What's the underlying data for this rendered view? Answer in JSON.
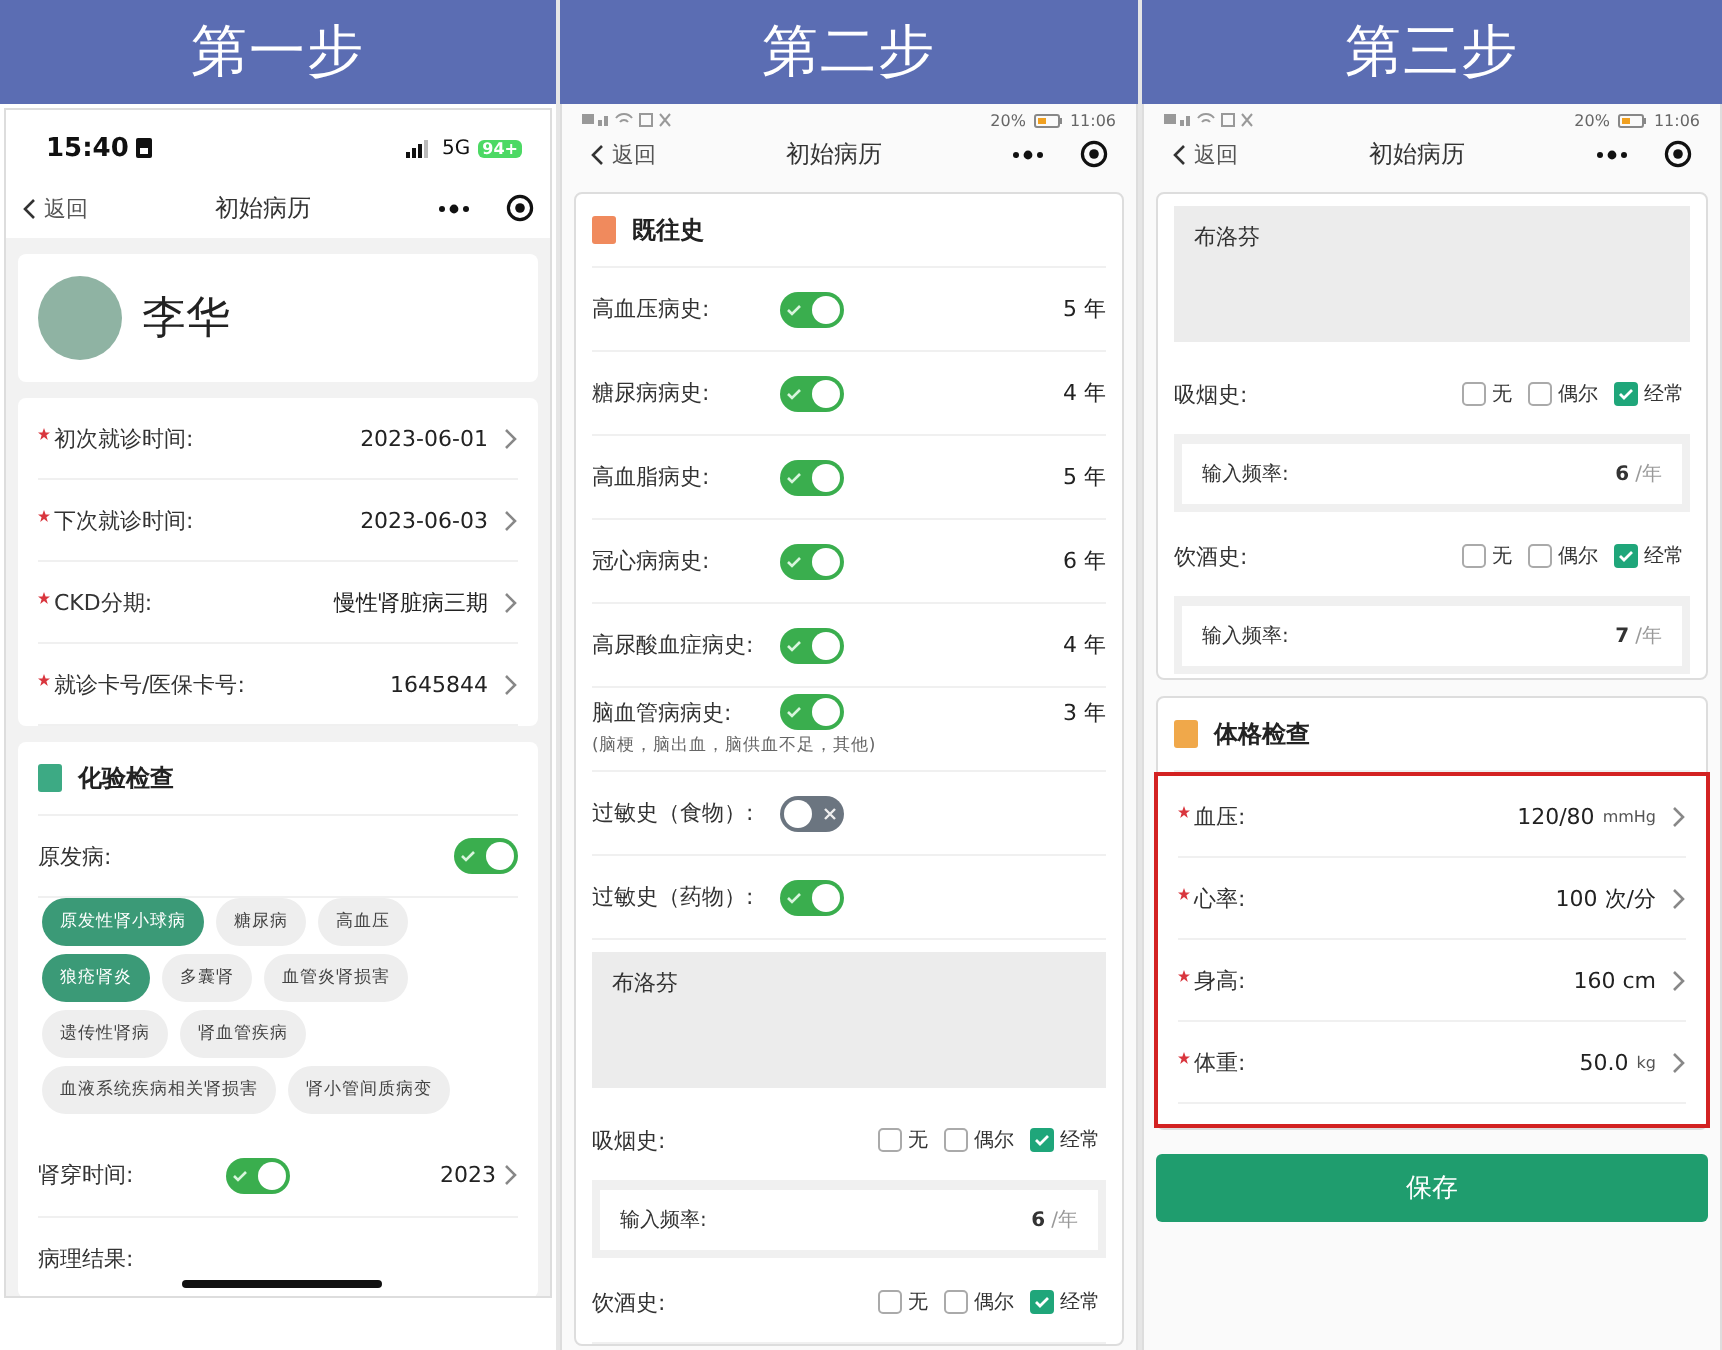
{
  "steps": [
    {
      "title": "第一步",
      "screen": {
        "status": {
          "kind": "ios",
          "time": "15:40",
          "network": "5G",
          "battery": "94+"
        },
        "nav": {
          "back": "返回",
          "title": "初始病历"
        },
        "cards": [
          {
            "rows": [
              {
                "kind": "profile",
                "name": "李华"
              }
            ]
          },
          {
            "rows": [
              {
                "kind": "field",
                "required": true,
                "label": "初次就诊时间:",
                "value": "2023-06-01"
              },
              {
                "kind": "field",
                "required": true,
                "label": "下次就诊时间:",
                "value": "2023-06-03"
              },
              {
                "kind": "field",
                "required": true,
                "label": "CKD分期:",
                "value": "慢性肾脏病三期"
              },
              {
                "kind": "field",
                "required": true,
                "label": "就诊卡号/医保卡号:",
                "value": "1645844"
              }
            ]
          },
          {
            "rows": [
              {
                "kind": "section",
                "title": "化验检查",
                "color": "#3daa84"
              },
              {
                "kind": "toggle_end",
                "label": "原发病:",
                "on": true
              },
              {
                "kind": "chips",
                "chips": [
                  {
                    "label": "原发性肾小球病",
                    "selected": true
                  },
                  {
                    "label": "糖尿病",
                    "selected": false
                  },
                  {
                    "label": "高血压",
                    "selected": false
                  },
                  {
                    "label": "狼疮肾炎",
                    "selected": true
                  },
                  {
                    "label": "多囊肾",
                    "selected": false
                  },
                  {
                    "label": "血管炎肾损害",
                    "selected": false
                  },
                  {
                    "label": "遗传性肾病",
                    "selected": false
                  },
                  {
                    "label": "肾血管疾病",
                    "selected": false
                  },
                  {
                    "label": "血液系统疾病相关肾损害",
                    "selected": false
                  },
                  {
                    "label": "肾小管间质病变",
                    "selected": false
                  }
                ]
              },
              {
                "kind": "toggle",
                "label": "肾穿时间:",
                "on": true,
                "value": "2023",
                "chevron": true
              },
              {
                "kind": "label",
                "text": "病理结果:"
              }
            ]
          }
        ]
      }
    },
    {
      "title": "第二步",
      "screen": {
        "status": {
          "kind": "android",
          "battery": "20%",
          "time": "11:06"
        },
        "nav": {
          "back": "返回",
          "title": "初始病历"
        },
        "cards": [
          {
            "rows": [
              {
                "kind": "section",
                "title": "既往史",
                "color": "#f08a5d"
              },
              {
                "kind": "toggle",
                "label": "高血压病史:",
                "on": true,
                "value": "5 年"
              },
              {
                "kind": "toggle",
                "label": "糖尿病病史:",
                "on": true,
                "value": "4 年"
              },
              {
                "kind": "toggle",
                "label": "高血脂病史:",
                "on": true,
                "value": "5 年"
              },
              {
                "kind": "toggle",
                "label": "冠心病病史:",
                "on": true,
                "value": "6 年"
              },
              {
                "kind": "toggle",
                "label": "高尿酸血症病史:",
                "on": true,
                "value": "4 年"
              },
              {
                "kind": "toggle",
                "label": "脑血管病病史:",
                "on": true,
                "value": "3 年",
                "note": "(脑梗，脑出血，脑供血不足，其他)"
              },
              {
                "kind": "toggle",
                "label": "过敏史（食物）:",
                "on": false
              },
              {
                "kind": "toggle",
                "label": "过敏史（药物）:",
                "on": true
              },
              {
                "kind": "textarea",
                "text": "布洛芬"
              },
              {
                "kind": "choice",
                "label": "吸烟史:",
                "options": [
                  {
                    "label": "无",
                    "checked": false
                  },
                  {
                    "label": "偶尔",
                    "checked": false
                  },
                  {
                    "label": "经常",
                    "checked": true
                  }
                ]
              },
              {
                "kind": "frequency",
                "label": "输入频率:",
                "value": "6",
                "unit": "/年"
              },
              {
                "kind": "choice",
                "label": "饮酒史:",
                "options": [
                  {
                    "label": "无",
                    "checked": false
                  },
                  {
                    "label": "偶尔",
                    "checked": false
                  },
                  {
                    "label": "经常",
                    "checked": true
                  }
                ]
              }
            ]
          }
        ]
      }
    },
    {
      "title": "第三步",
      "screen": {
        "status": {
          "kind": "android",
          "battery": "20%",
          "time": "11:06"
        },
        "nav": {
          "back": "返回",
          "title": "初始病历"
        },
        "cards": [
          {
            "rows": [
              {
                "kind": "textarea",
                "text": "布洛芬"
              },
              {
                "kind": "choice",
                "label": "吸烟史:",
                "options": [
                  {
                    "label": "无",
                    "checked": false
                  },
                  {
                    "label": "偶尔",
                    "checked": false
                  },
                  {
                    "label": "经常",
                    "checked": true
                  }
                ]
              },
              {
                "kind": "frequency",
                "label": "输入频率:",
                "value": "6",
                "unit": "/年"
              },
              {
                "kind": "choice",
                "label": "饮酒史:",
                "options": [
                  {
                    "label": "无",
                    "checked": false
                  },
                  {
                    "label": "偶尔",
                    "checked": false
                  },
                  {
                    "label": "经常",
                    "checked": true
                  }
                ]
              },
              {
                "kind": "frequency",
                "label": "输入频率:",
                "value": "7",
                "unit": "/年"
              }
            ]
          },
          {
            "rows": [
              {
                "kind": "section",
                "title": "体格检查",
                "color": "#f0a84a"
              },
              {
                "kind": "highlight",
                "rows": [
                  {
                    "kind": "field",
                    "required": true,
                    "label": "血压:",
                    "value": "120/80",
                    "unit": "mmHg"
                  },
                  {
                    "kind": "field",
                    "required": true,
                    "label": "心率:",
                    "value": "100 次/分"
                  },
                  {
                    "kind": "field",
                    "required": true,
                    "label": "身高:",
                    "value": "160 cm"
                  },
                  {
                    "kind": "field",
                    "required": true,
                    "label": "体重:",
                    "value": "50.0",
                    "unit": "kg"
                  }
                ]
              }
            ]
          }
        ],
        "button": {
          "label": "保存"
        }
      }
    }
  ]
}
